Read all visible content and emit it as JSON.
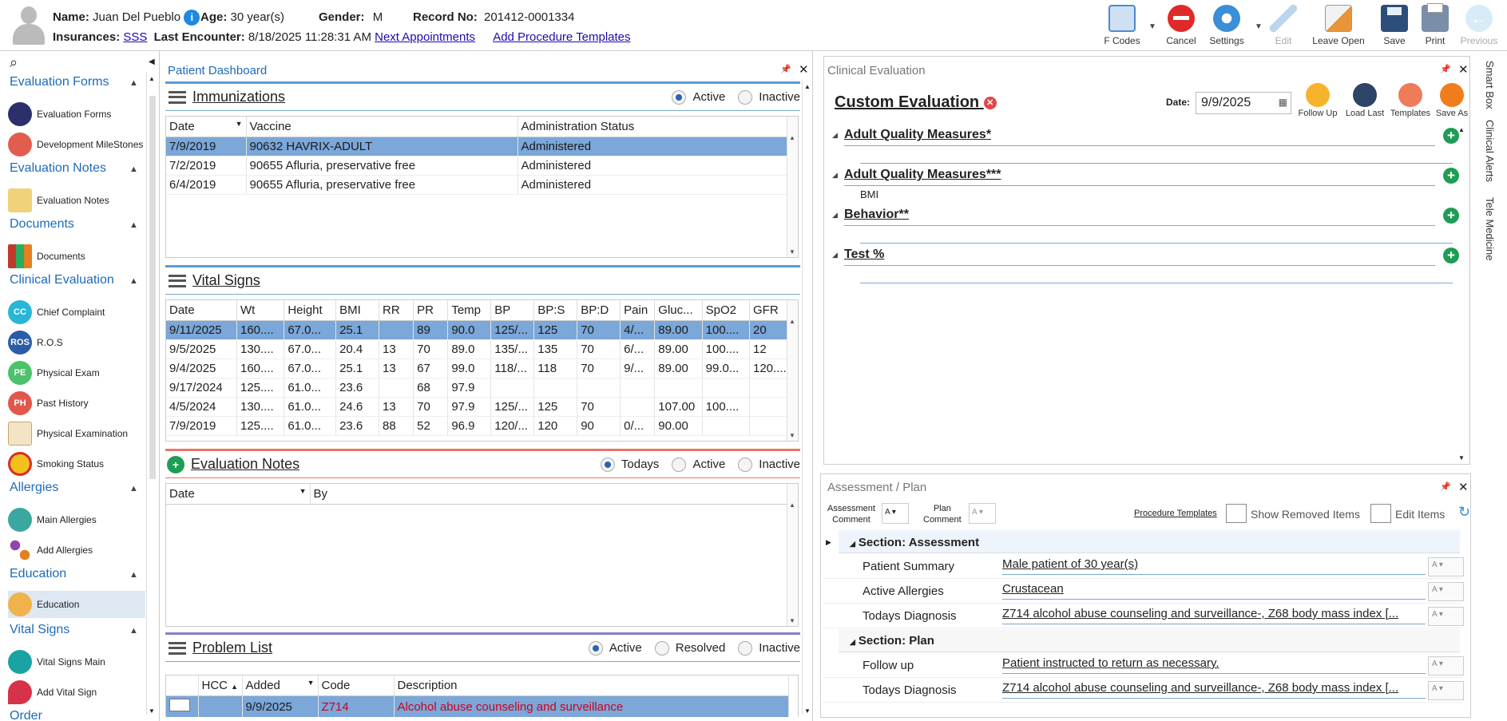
{
  "header": {
    "name_label": "Name:",
    "name": "Juan Del Pueblo",
    "age_label": "Age:",
    "age": "30 year(s)",
    "gender_label": "Gender:",
    "gender": "M",
    "record_label": "Record No:",
    "record": "201412-0001334",
    "insurances_label": "Insurances:",
    "insurance": "SSS",
    "last_encounter_label": "Last Encounter:",
    "last_encounter": "8/18/2025 11:28:31 AM",
    "next_appointments": "Next Appointments",
    "add_procedure_templates": "Add Procedure Templates"
  },
  "toolbar": {
    "fcodes": "F Codes",
    "cancel": "Cancel",
    "settings": "Settings",
    "edit": "Edit",
    "leave_open": "Leave Open",
    "save": "Save",
    "print": "Print",
    "previous": "Previous"
  },
  "sidebar": {
    "groups": {
      "evaluation_forms": "Evaluation Forms",
      "evaluation_notes": "Evaluation Notes",
      "documents": "Documents",
      "clinical_evaluation": "Clinical Evaluation",
      "allergies": "Allergies",
      "education": "Education",
      "vital_signs": "Vital Signs",
      "order": "Order"
    },
    "items": {
      "evaluation_forms": "Evaluation Forms",
      "development_milestones": "Development MileStones",
      "evaluation_notes": "Evaluation Notes",
      "documents": "Documents",
      "chief_complaint": "Chief Complaint",
      "ros": "R.O.S",
      "physical_exam": "Physical Exam",
      "past_history": "Past History",
      "physical_examination": "Physical Examination",
      "smoking_status": "Smoking Status",
      "main_allergies": "Main Allergies",
      "add_allergies": "Add Allergies",
      "education": "Education",
      "vital_signs_main": "Vital Signs Main",
      "add_vital_sign": "Add Vital Sign"
    },
    "icon_text": {
      "cc": "CC",
      "ros": "ROS",
      "pe": "PE",
      "ph": "PH"
    }
  },
  "dashboard": {
    "title": "Patient Dashboard",
    "immunizations": {
      "title": "Immunizations",
      "filters": [
        "Active",
        "Inactive"
      ],
      "columns": [
        "Date",
        "Vaccine",
        "Administration Status"
      ],
      "rows": [
        [
          "7/9/2019",
          "90632 HAVRIX-ADULT",
          "Administered"
        ],
        [
          "7/2/2019",
          "90655 Afluria, preservative free",
          "Administered"
        ],
        [
          "6/4/2019",
          "90655 Afluria, preservative free",
          "Administered"
        ]
      ]
    },
    "vitals": {
      "title": "Vital Signs",
      "columns": [
        "Date",
        "Wt",
        "Height",
        "BMI",
        "RR",
        "PR",
        "Temp",
        "BP",
        "BP:S",
        "BP:D",
        "Pain",
        "Gluc...",
        "SpO2",
        "GFR"
      ],
      "rows": [
        [
          "9/11/2025",
          "160....",
          "67.0...",
          "25.1",
          "",
          "89",
          "90.0",
          "125/...",
          "125",
          "70",
          "4/...",
          "89.00",
          "100....",
          "20"
        ],
        [
          "9/5/2025",
          "130....",
          "67.0...",
          "20.4",
          "13",
          "70",
          "89.0",
          "135/...",
          "135",
          "70",
          "6/...",
          "89.00",
          "100....",
          "12"
        ],
        [
          "9/4/2025",
          "160....",
          "67.0...",
          "25.1",
          "13",
          "67",
          "99.0",
          "118/...",
          "118",
          "70",
          "9/...",
          "89.00",
          "99.0...",
          "120...."
        ],
        [
          "9/17/2024",
          "125....",
          "61.0...",
          "23.6",
          "",
          "68",
          "97.9",
          "",
          "",
          "",
          "",
          "",
          "",
          ""
        ],
        [
          "4/5/2024",
          "130....",
          "61.0...",
          "24.6",
          "13",
          "70",
          "97.9",
          "125/...",
          "125",
          "70",
          "",
          "107.00",
          "100....",
          ""
        ],
        [
          "7/9/2019",
          "125....",
          "61.0...",
          "23.6",
          "88",
          "52",
          "96.9",
          "120/...",
          "120",
          "90",
          "0/...",
          "90.00",
          "",
          ""
        ]
      ]
    },
    "eval_notes": {
      "title": "Evaluation Notes",
      "filters": [
        "Todays",
        "Active",
        "Inactive"
      ],
      "columns": [
        "Date",
        "By"
      ]
    },
    "problems": {
      "title": "Problem List",
      "filters": [
        "Active",
        "Resolved",
        "Inactive"
      ],
      "columns": [
        "HCC",
        "Added",
        "Code",
        "Description"
      ],
      "row": [
        "",
        "9/9/2025",
        "Z714",
        "Alcohol abuse counseling and surveillance"
      ]
    }
  },
  "clinical": {
    "panel_title": "Clinical Evaluation",
    "title": "Custom Evaluation",
    "date_label": "Date:",
    "date": "9/9/2025",
    "actions": [
      "Follow Up",
      "Load Last",
      "Templates",
      "Save As"
    ],
    "measures": [
      "Adult Quality Measures*",
      "Adult Quality Measures***",
      "Behavior**",
      "Test %"
    ],
    "bmi": "BMI"
  },
  "assessment": {
    "panel_title": "Assessment / Plan",
    "assessment_comment": [
      "Assessment",
      "Comment"
    ],
    "plan_comment": [
      "Plan",
      "Comment"
    ],
    "procedure_templates": "Procedure Templates",
    "show_removed": "Show Removed Items",
    "edit_items": "Edit Items",
    "section_assessment": "Section: Assessment",
    "section_plan": "Section: Plan",
    "rows": [
      {
        "k": "Patient Summary",
        "v": "Male patient of 30 year(s)"
      },
      {
        "k": "Active Allergies",
        "v": "Crustacean"
      },
      {
        "k": "Todays Diagnosis",
        "v": "Z714 alcohol abuse counseling and surveillance-, Z68 body mass index [..."
      },
      {
        "k": "Follow up",
        "v": "Patient instructed to return as necessary."
      },
      {
        "k": "Todays Diagnosis",
        "v": "Z714 alcohol abuse counseling and surveillance-, Z68 body mass index [..."
      }
    ]
  },
  "right_tabs": [
    "Smart Box",
    "Clinical Alerts",
    "Tele Medicine"
  ],
  "colors": {
    "accent": "#1e6bb8",
    "selection": "#7ba7d9",
    "add": "#1f9d55",
    "problem_code": "#d0021b"
  }
}
